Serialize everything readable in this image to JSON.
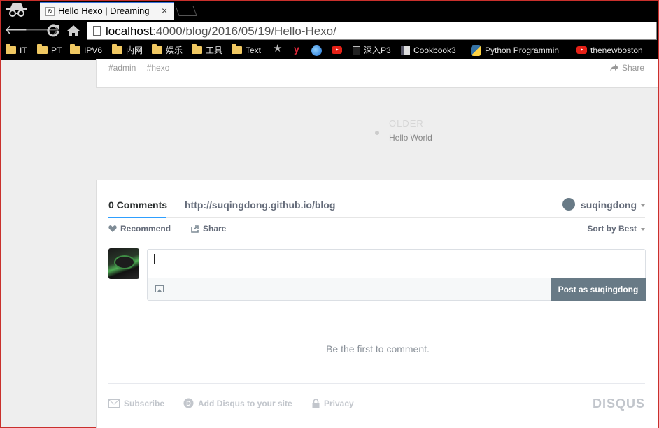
{
  "browser": {
    "tab": {
      "favicon_text": "&",
      "title": "Hello Hexo | Dreaming",
      "close": "×"
    },
    "url": {
      "host": "localhost",
      "path": ":4000/blog/2016/05/19/Hello-Hexo/"
    },
    "bookmarks": [
      {
        "label": "IT",
        "icon": "folder-icon"
      },
      {
        "label": "PT",
        "icon": "folder-icon"
      },
      {
        "label": "IPV6",
        "icon": "folder-icon"
      },
      {
        "label": "内网",
        "icon": "folder-icon"
      },
      {
        "label": "娱乐",
        "icon": "folder-icon"
      },
      {
        "label": "工具",
        "icon": "folder-icon"
      },
      {
        "label": "Text",
        "icon": "folder-icon"
      },
      {
        "label": "",
        "icon": "star-icon"
      },
      {
        "label": "y",
        "icon": "y-icon"
      },
      {
        "label": "",
        "icon": "globe-icon"
      },
      {
        "label": "",
        "icon": "youtube-icon"
      },
      {
        "label": "深入P3",
        "icon": "page-icon"
      },
      {
        "label": "Cookbook3",
        "icon": "book-icon"
      },
      {
        "label": "Python Programmin",
        "icon": "python-icon"
      },
      {
        "label": "thenewboston",
        "icon": "youtube-icon"
      }
    ]
  },
  "post": {
    "tags": [
      "#admin",
      "#hexo"
    ],
    "share_label": "Share"
  },
  "pager": {
    "older_label": "OLDER",
    "older_title": "Hello World"
  },
  "disqus": {
    "comment_count": "0 Comments",
    "site_link": "http://suqingdong.github.io/blog",
    "username": "suqingdong",
    "recommend": "Recommend",
    "share": "Share",
    "sort": "Sort by Best",
    "post_button": "Post as suqingdong",
    "empty_text": "Be the first to comment.",
    "footer": {
      "subscribe": "Subscribe",
      "add_disqus": "Add Disqus to your site",
      "privacy": "Privacy",
      "logo": "DISQUS"
    }
  },
  "colors": {
    "accent": "#2e9fff",
    "button": "#687a86",
    "text_muted": "#656c7a"
  }
}
